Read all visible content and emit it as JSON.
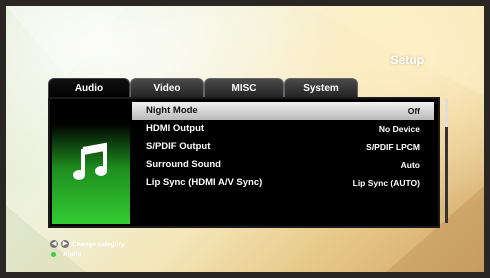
{
  "header": {
    "title": "Setup"
  },
  "tabs": [
    {
      "label": "Audio",
      "active": true
    },
    {
      "label": "Video",
      "active": false
    },
    {
      "label": "MISC",
      "active": false
    },
    {
      "label": "System",
      "active": false
    }
  ],
  "settings": [
    {
      "label": "Night Mode",
      "value": "Off",
      "selected": true
    },
    {
      "label": "HDMI Output",
      "value": "No Device",
      "selected": false
    },
    {
      "label": "S/PDIF Output",
      "value": "S/PDIF LPCM",
      "selected": false
    },
    {
      "label": "Surround Sound",
      "value": "Auto",
      "selected": false
    },
    {
      "label": "Lip Sync (HDMI A/V Sync)",
      "value": "Lip Sync (AUTO)",
      "selected": false
    }
  ],
  "category_icon": "music-note-icon",
  "footer": {
    "change_category": "Change category",
    "current_category": "Audio"
  },
  "colors": {
    "icon_gradient_end": "#33cc33",
    "selected_row": "#e0e0e0",
    "panel_bg": "#000000"
  }
}
